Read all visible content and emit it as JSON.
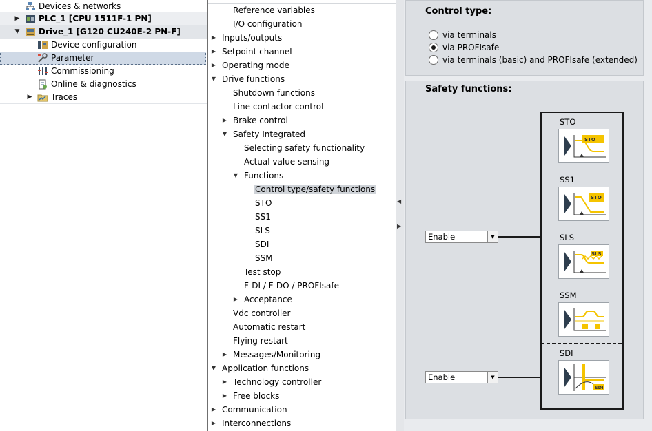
{
  "project_tree": {
    "items": [
      {
        "label": "Devices & networks",
        "icon": "network-icon"
      },
      {
        "label": "PLC_1 [CPU 1511F-1 PN]",
        "icon": "plc-icon"
      },
      {
        "label": "Drive_1 [G120 CU240E-2 PN-F]",
        "icon": "drive-icon"
      },
      {
        "label": "Device configuration",
        "icon": "device-config-icon"
      },
      {
        "label": "Parameter",
        "icon": "parameter-icon"
      },
      {
        "label": "Commissioning",
        "icon": "commissioning-icon"
      },
      {
        "label": "Online & diagnostics",
        "icon": "diagnostics-icon"
      },
      {
        "label": "Traces",
        "icon": "traces-icon"
      }
    ],
    "selected": "Parameter"
  },
  "nav_tree": {
    "items": [
      {
        "label": "Reference variables"
      },
      {
        "label": "I/O configuration"
      },
      {
        "label": "Inputs/outputs"
      },
      {
        "label": "Setpoint channel"
      },
      {
        "label": "Operating mode"
      },
      {
        "label": "Drive functions"
      },
      {
        "label": "Shutdown functions"
      },
      {
        "label": "Line contactor control"
      },
      {
        "label": "Brake control"
      },
      {
        "label": "Safety Integrated"
      },
      {
        "label": "Selecting safety functionality"
      },
      {
        "label": "Actual value sensing"
      },
      {
        "label": "Functions"
      },
      {
        "label": "Control type/safety functions"
      },
      {
        "label": "STO"
      },
      {
        "label": "SS1"
      },
      {
        "label": "SLS"
      },
      {
        "label": "SDI"
      },
      {
        "label": "SSM"
      },
      {
        "label": "Test stop"
      },
      {
        "label": "F-DI / F-DO / PROFIsafe"
      },
      {
        "label": "Acceptance"
      },
      {
        "label": "Vdc controller"
      },
      {
        "label": "Automatic restart"
      },
      {
        "label": "Flying restart"
      },
      {
        "label": "Messages/Monitoring"
      },
      {
        "label": "Application functions"
      },
      {
        "label": "Technology controller"
      },
      {
        "label": "Free blocks"
      },
      {
        "label": "Communication"
      },
      {
        "label": "Interconnections"
      }
    ],
    "selected": "Control type/safety functions"
  },
  "control_type": {
    "title": "Control type:",
    "options": [
      {
        "label": "via terminals",
        "checked": false
      },
      {
        "label": "via PROFIsafe",
        "checked": true
      },
      {
        "label": "via terminals (basic) and PROFIsafe (extended)",
        "checked": false
      }
    ]
  },
  "safety_functions": {
    "title": "Safety functions:",
    "enable_select_1": "Enable",
    "enable_select_2": "Enable",
    "functions": [
      {
        "label": "STO",
        "badge": "STO"
      },
      {
        "label": "SS1",
        "badge": "STO"
      },
      {
        "label": "SLS",
        "badge": "SLS"
      },
      {
        "label": "SSM",
        "badge": ""
      },
      {
        "label": "SDI",
        "badge": "SDI"
      }
    ]
  },
  "colors": {
    "accent_yellow": "#f5c400",
    "selection": "#cfd3d8",
    "panel": "#dcdfe3"
  }
}
